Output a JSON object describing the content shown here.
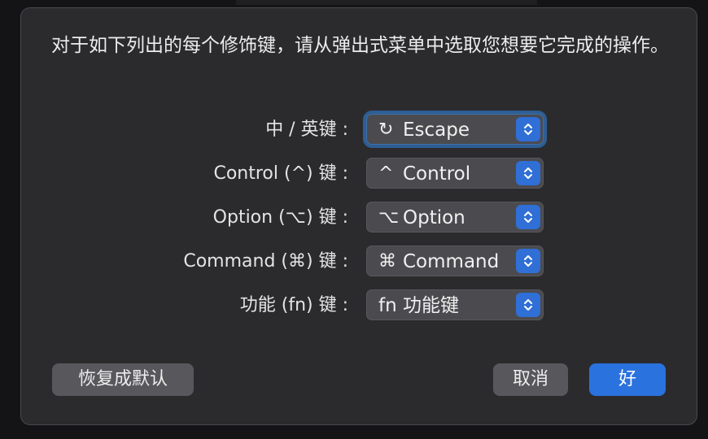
{
  "dialog": {
    "instructions": "对于如下列出的每个修饰键，请从弹出式菜单中选取您想要它完成的操作。",
    "rows": [
      {
        "label": "中 / 英键 :",
        "glyph": "↻",
        "value": "Escape"
      },
      {
        "label": "Control (^) 键 :",
        "glyph": "^",
        "value": "Control"
      },
      {
        "label": "Option (⌥) 键 :",
        "glyph": "⌥",
        "value": "Option"
      },
      {
        "label": "Command (⌘) 键 :",
        "glyph": "⌘",
        "value": "Command"
      },
      {
        "label": "功能 (fn) 键 :",
        "glyph": "",
        "value": "fn 功能键"
      }
    ],
    "buttons": {
      "restore_defaults": "恢复成默认",
      "cancel": "取消",
      "ok": "好"
    }
  },
  "colors": {
    "accent": "#2a72de",
    "dialog_background": "#2b2b2e",
    "popup_background": "#4b4b4f"
  },
  "icons": {
    "stepper": "up-down-chevron-icon",
    "escape": "rotate-arrow-icon"
  }
}
